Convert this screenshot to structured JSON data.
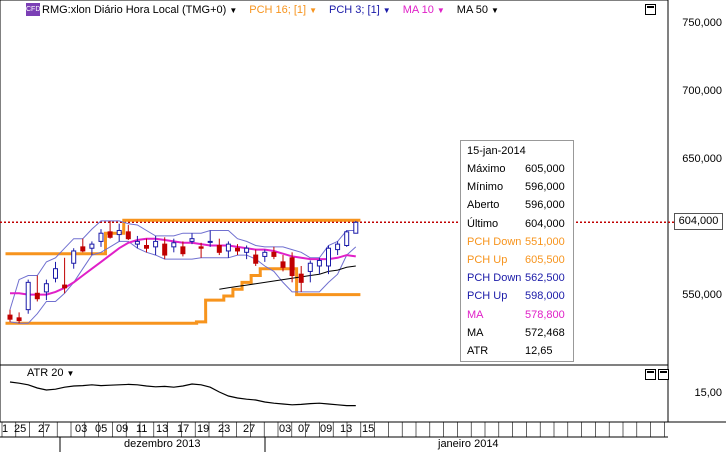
{
  "legend": {
    "symbol_badge": "CFD",
    "symbol": "RMG:xlon Diário Hora Local (TMG+0)",
    "pch16": "PCH 16; [1]",
    "pch3": "PCH 3; [1]",
    "ma10": "MA 10",
    "ma50": "MA 50"
  },
  "colors": {
    "pch16": "#f7941d",
    "pch3": "#1a1aa8",
    "ma10": "#e020c8",
    "ma50": "#000000",
    "price_line": "#c00000"
  },
  "y_axis": {
    "labels": [
      "750,000",
      "700,000",
      "650,000",
      "600,000",
      "550,000"
    ],
    "current_price": "604,000"
  },
  "atr_axis": {
    "labels": [
      "15,00"
    ]
  },
  "info_box": {
    "date": "15-jan-2014",
    "rows": [
      {
        "k": "Máximo",
        "v": "605,000",
        "color": "#000000"
      },
      {
        "k": "Mínimo",
        "v": "596,000",
        "color": "#000000"
      },
      {
        "k": "Aberto",
        "v": "596,000",
        "color": "#000000"
      },
      {
        "k": "Último",
        "v": "604,000",
        "color": "#000000"
      },
      {
        "k": "PCH Down",
        "v": "551,000",
        "color": "#f7941d"
      },
      {
        "k": "PCH Up",
        "v": "605,500",
        "color": "#f7941d"
      },
      {
        "k": "PCH Down",
        "v": "562,500",
        "color": "#1a1aa8"
      },
      {
        "k": "PCH Up",
        "v": "598,000",
        "color": "#1a1aa8"
      },
      {
        "k": "MA",
        "v": "578,800",
        "color": "#e020c8"
      },
      {
        "k": "MA",
        "v": "572,468",
        "color": "#000000"
      },
      {
        "k": "ATR",
        "v": "12,65",
        "color": "#000000"
      }
    ]
  },
  "atr_label": "ATR 20",
  "x_axis": {
    "days": [
      "1",
      "25",
      "27",
      "03",
      "05",
      "09",
      "11",
      "13",
      "17",
      "19",
      "23",
      "27",
      "03",
      "07",
      "09",
      "13",
      "15"
    ],
    "months": [
      "dezembro 2013",
      "janeiro 2014"
    ]
  },
  "chart_data": {
    "type": "candlestick",
    "title": "RMG:xlon Diário Hora Local (TMG+0)",
    "ylim": [
      520,
      765
    ],
    "ticks": [
      750,
      700,
      650,
      600,
      550
    ],
    "current_price": 604,
    "candles": [
      {
        "o": 536,
        "h": 540,
        "l": 531,
        "c": 533
      },
      {
        "o": 534,
        "h": 538,
        "l": 530,
        "c": 532
      },
      {
        "o": 540,
        "h": 562,
        "l": 537,
        "c": 560
      },
      {
        "o": 552,
        "h": 565,
        "l": 546,
        "c": 548
      },
      {
        "o": 553,
        "h": 562,
        "l": 547,
        "c": 559
      },
      {
        "o": 563,
        "h": 575,
        "l": 560,
        "c": 570
      },
      {
        "o": 558,
        "h": 578,
        "l": 552,
        "c": 556
      },
      {
        "o": 574,
        "h": 585,
        "l": 570,
        "c": 583
      },
      {
        "o": 586,
        "h": 592,
        "l": 582,
        "c": 583
      },
      {
        "o": 585,
        "h": 590,
        "l": 580,
        "c": 588
      },
      {
        "o": 590,
        "h": 599,
        "l": 586,
        "c": 596
      },
      {
        "o": 597,
        "h": 605,
        "l": 592,
        "c": 593
      },
      {
        "o": 595,
        "h": 603,
        "l": 590,
        "c": 598
      },
      {
        "o": 597,
        "h": 602,
        "l": 591,
        "c": 592
      },
      {
        "o": 588,
        "h": 594,
        "l": 585,
        "c": 590
      },
      {
        "o": 587,
        "h": 592,
        "l": 582,
        "c": 585
      },
      {
        "o": 586,
        "h": 594,
        "l": 580,
        "c": 590
      },
      {
        "o": 588,
        "h": 593,
        "l": 577,
        "c": 580
      },
      {
        "o": 586,
        "h": 592,
        "l": 582,
        "c": 589
      },
      {
        "o": 586,
        "h": 590,
        "l": 579,
        "c": 581
      },
      {
        "o": 590,
        "h": 596,
        "l": 588,
        "c": 592
      },
      {
        "o": 586,
        "h": 589,
        "l": 578,
        "c": 585
      },
      {
        "o": 590,
        "h": 598,
        "l": 586,
        "c": 590
      },
      {
        "o": 587,
        "h": 592,
        "l": 580,
        "c": 582
      },
      {
        "o": 583,
        "h": 590,
        "l": 578,
        "c": 588
      },
      {
        "o": 585,
        "h": 588,
        "l": 580,
        "c": 583
      },
      {
        "o": 582,
        "h": 587,
        "l": 577,
        "c": 585
      },
      {
        "o": 580,
        "h": 584,
        "l": 572,
        "c": 574
      },
      {
        "o": 579,
        "h": 584,
        "l": 575,
        "c": 582
      },
      {
        "o": 582,
        "h": 586,
        "l": 577,
        "c": 579
      },
      {
        "o": 575,
        "h": 580,
        "l": 568,
        "c": 571
      },
      {
        "o": 578,
        "h": 582,
        "l": 560,
        "c": 565
      },
      {
        "o": 566,
        "h": 572,
        "l": 553,
        "c": 560
      },
      {
        "o": 568,
        "h": 576,
        "l": 560,
        "c": 574
      },
      {
        "o": 572,
        "h": 578,
        "l": 566,
        "c": 576
      },
      {
        "o": 572,
        "h": 587,
        "l": 566,
        "c": 585
      },
      {
        "o": 584,
        "h": 590,
        "l": 580,
        "c": 588
      },
      {
        "o": 587,
        "h": 598,
        "l": 586,
        "c": 597
      },
      {
        "o": 596,
        "h": 605,
        "l": 596,
        "c": 604
      }
    ],
    "pch16_up": [
      581,
      581,
      581,
      581,
      581,
      581,
      581,
      581,
      581,
      581,
      581,
      596,
      596,
      605.5,
      605.5,
      605.5,
      605.5,
      605.5,
      605.5,
      605.5,
      605.5,
      605.5,
      605.5,
      605.5,
      605.5,
      605.5,
      605.5,
      605.5,
      605.5,
      605.5,
      605.5,
      605.5,
      605.5,
      605.5,
      605.5,
      605.5,
      605.5,
      605.5,
      605.5
    ],
    "pch16_down": [
      530,
      530,
      530,
      530,
      530,
      530,
      530,
      530,
      530,
      530,
      530,
      530,
      530,
      530,
      530,
      530,
      530,
      530,
      530,
      530,
      530,
      531,
      547,
      547,
      550,
      555,
      560,
      565,
      570,
      570,
      570,
      570,
      551,
      551,
      551,
      551,
      551,
      551,
      551
    ],
    "pch3_up": [
      540,
      562,
      565,
      565,
      575,
      578,
      585,
      592,
      592,
      599,
      605,
      605,
      605,
      603,
      602,
      598,
      594,
      594,
      594,
      596,
      596,
      596,
      598,
      598,
      598,
      592,
      590,
      587,
      586,
      586,
      586,
      584,
      582,
      578,
      578,
      587,
      590,
      598,
      598
    ],
    "pch3_down": [
      531,
      530,
      530,
      537,
      546,
      546,
      552,
      560,
      570,
      580,
      582,
      586,
      590,
      590,
      585,
      582,
      580,
      577,
      577,
      577,
      577,
      578,
      578,
      578,
      578,
      580,
      580,
      577,
      572,
      568,
      560,
      553,
      553,
      553,
      553,
      560,
      566,
      580,
      586
    ],
    "ma10": [
      552,
      552,
      551,
      551,
      551,
      553,
      556,
      560,
      565,
      570,
      575,
      580,
      585,
      589,
      591,
      592,
      592,
      591,
      590,
      589,
      589,
      588,
      587,
      587,
      587,
      586,
      585,
      584,
      584,
      583,
      581,
      579,
      578,
      577,
      577,
      577,
      578,
      580,
      579
    ],
    "ma50": [
      null,
      null,
      null,
      null,
      null,
      null,
      null,
      null,
      null,
      null,
      null,
      null,
      null,
      null,
      null,
      null,
      null,
      null,
      null,
      null,
      null,
      null,
      null,
      555,
      556,
      557,
      558,
      559,
      560,
      561,
      562,
      563,
      564,
      565,
      566,
      568,
      569,
      571,
      572
    ],
    "atr_ylim": [
      8,
      20
    ],
    "atr": [
      17.5,
      17.2,
      16.8,
      16.0,
      15.5,
      15.7,
      16.2,
      16.5,
      16.6,
      16.8,
      16.6,
      16.7,
      16.8,
      16.9,
      16.8,
      16.5,
      16.3,
      16.4,
      16.2,
      16.5,
      17.0,
      16.8,
      16.2,
      15.0,
      14.0,
      13.5,
      13.2,
      13.0,
      12.5,
      12.2,
      12.0,
      11.8,
      11.9,
      12.1,
      12.2,
      12.0,
      11.8,
      11.6,
      11.6
    ]
  }
}
